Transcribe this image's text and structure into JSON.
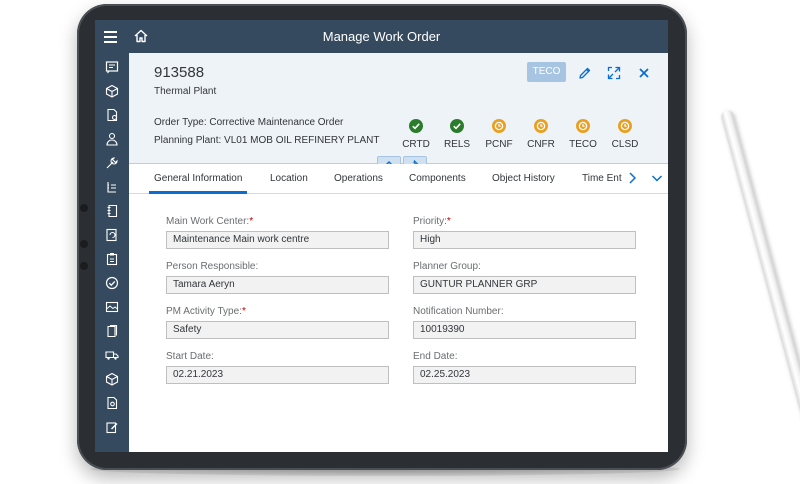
{
  "shell": {
    "title": "Manage Work Order",
    "menu_icon": "hamburger-menu-icon",
    "home_icon": "home-icon"
  },
  "sidebar": {
    "items": [
      {
        "icon": "work-order-icon"
      },
      {
        "icon": "cube-icon"
      },
      {
        "icon": "document-settings-icon"
      },
      {
        "icon": "technician-icon"
      },
      {
        "icon": "tools-icon"
      },
      {
        "icon": "checklist-icon"
      },
      {
        "icon": "notebook-icon"
      },
      {
        "icon": "refresh-document-icon"
      },
      {
        "icon": "clipboard-icon"
      },
      {
        "icon": "check-circle-icon"
      },
      {
        "icon": "gallery-icon"
      },
      {
        "icon": "book-icon"
      },
      {
        "icon": "truck-icon"
      },
      {
        "icon": "cube-outline-icon"
      },
      {
        "icon": "document-gear-icon"
      },
      {
        "icon": "edit-document-icon"
      }
    ]
  },
  "header": {
    "object_id": "913588",
    "object_subtitle": "Thermal Plant",
    "teco_button": "TECO",
    "edit_icon": "pencil-icon",
    "fullscreen_icon": "expand-icon",
    "close_icon": "close-icon"
  },
  "attributes": {
    "order_type": "Order Type: Corrective Maintenance Order",
    "planning_plant": "Planning Plant: VL01 MOB OIL REFINERY PLANT"
  },
  "statuses": [
    {
      "label": "CRTD",
      "state": "done",
      "color": "#2b7c2b"
    },
    {
      "label": "RELS",
      "state": "done",
      "color": "#2b7c2b"
    },
    {
      "label": "PCNF",
      "state": "pending",
      "color": "#e9a020"
    },
    {
      "label": "CNFR",
      "state": "pending",
      "color": "#e9a020"
    },
    {
      "label": "TECO",
      "state": "pending",
      "color": "#e9a020"
    },
    {
      "label": "CLSD",
      "state": "pending",
      "color": "#e9a020"
    }
  ],
  "tabs": [
    {
      "label": "General Information",
      "active": true
    },
    {
      "label": "Location"
    },
    {
      "label": "Operations"
    },
    {
      "label": "Components"
    },
    {
      "label": "Object History"
    },
    {
      "label": "Time Ent"
    }
  ],
  "form": {
    "main_work_center": {
      "label": "Main Work Center:",
      "required": true,
      "value": "Maintenance  Main work centre"
    },
    "priority": {
      "label": "Priority:",
      "required": true,
      "value": "High"
    },
    "person_responsible": {
      "label": "Person Responsible:",
      "value": "Tamara Aeryn"
    },
    "planner_group": {
      "label": "Planner Group:",
      "value": "GUNTUR PLANNER GRP"
    },
    "pm_activity_type": {
      "label": "PM Activity Type:",
      "required": true,
      "value": "Safety"
    },
    "notification_number": {
      "label": "Notification Number:",
      "value": "10019390"
    },
    "start_date": {
      "label": "Start Date:",
      "value": "02.21.2023"
    },
    "end_date": {
      "label": "End Date:",
      "value": "02.25.2023"
    }
  },
  "colors": {
    "shell": "#354a5f",
    "accent": "#0a6ed1",
    "header_bg": "#eef3f8",
    "status_green": "#2b7c2b",
    "status_orange": "#e9a020",
    "required": "#bb0000"
  }
}
